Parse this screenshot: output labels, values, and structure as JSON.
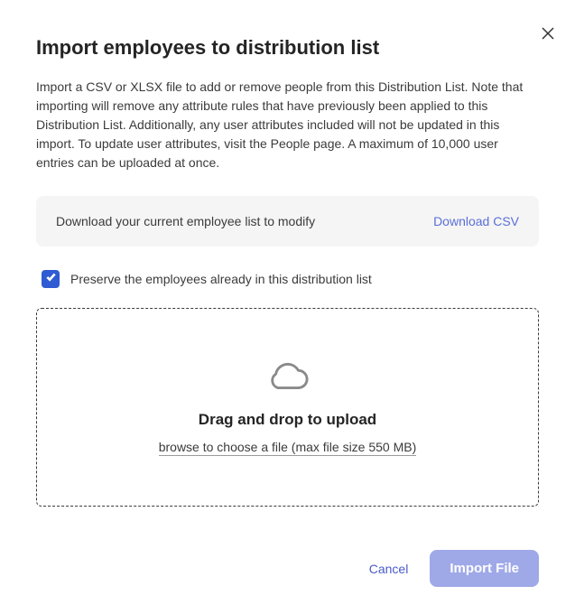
{
  "title": "Import employees to distribution list",
  "description": "Import a CSV or XLSX file to add or remove people from this Distribution List. Note that importing will remove any attribute rules that have previously been applied to this Distribution List. Additionally, any user attributes included will not be updated in this import. To update user attributes, visit the People page. A maximum of 10,000 user entries can be uploaded at once.",
  "downloadBar": {
    "text": "Download your current employee list to modify",
    "linkLabel": "Download CSV"
  },
  "preserveCheckbox": {
    "checked": true,
    "label": "Preserve the employees already in this distribution list"
  },
  "dropzone": {
    "title": "Drag and drop to upload",
    "subtitle": "browse to choose a file (max file size 550 MB)"
  },
  "footer": {
    "cancelLabel": "Cancel",
    "importLabel": "Import File"
  }
}
